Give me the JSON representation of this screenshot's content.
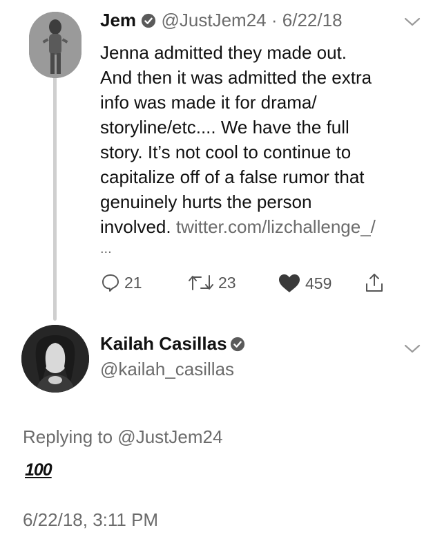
{
  "thread": {
    "tweet": {
      "name": "Jem",
      "handle": "@JustJem24",
      "separator": "·",
      "date": "6/22/18",
      "text_lines": [
        "Jenna admitted they made out.",
        "And then it was admitted the extra",
        "info was made it for drama/",
        "storyline/etc.... We have the full",
        "story. It’s not cool to continue to",
        "capitalize off of a false rumor that",
        "genuinely hurts the person",
        "involved."
      ],
      "link": "twitter.com/lizchallenge_/",
      "ellipsis": "...",
      "actions": {
        "replies": "21",
        "retweets": "23",
        "likes": "459"
      }
    },
    "reply_tweet": {
      "name": "Kailah Casillas",
      "handle": "@kailah_casillas",
      "replying_to": "Replying to @JustJem24",
      "emoji_text": "100",
      "timestamp": "6/22/18, 3:11 PM"
    }
  },
  "icons": {
    "verified": "verified-badge-icon",
    "chevron": "chevron-down-icon",
    "reply": "reply-icon",
    "retweet": "retweet-icon",
    "like": "heart-icon",
    "share": "share-icon"
  }
}
